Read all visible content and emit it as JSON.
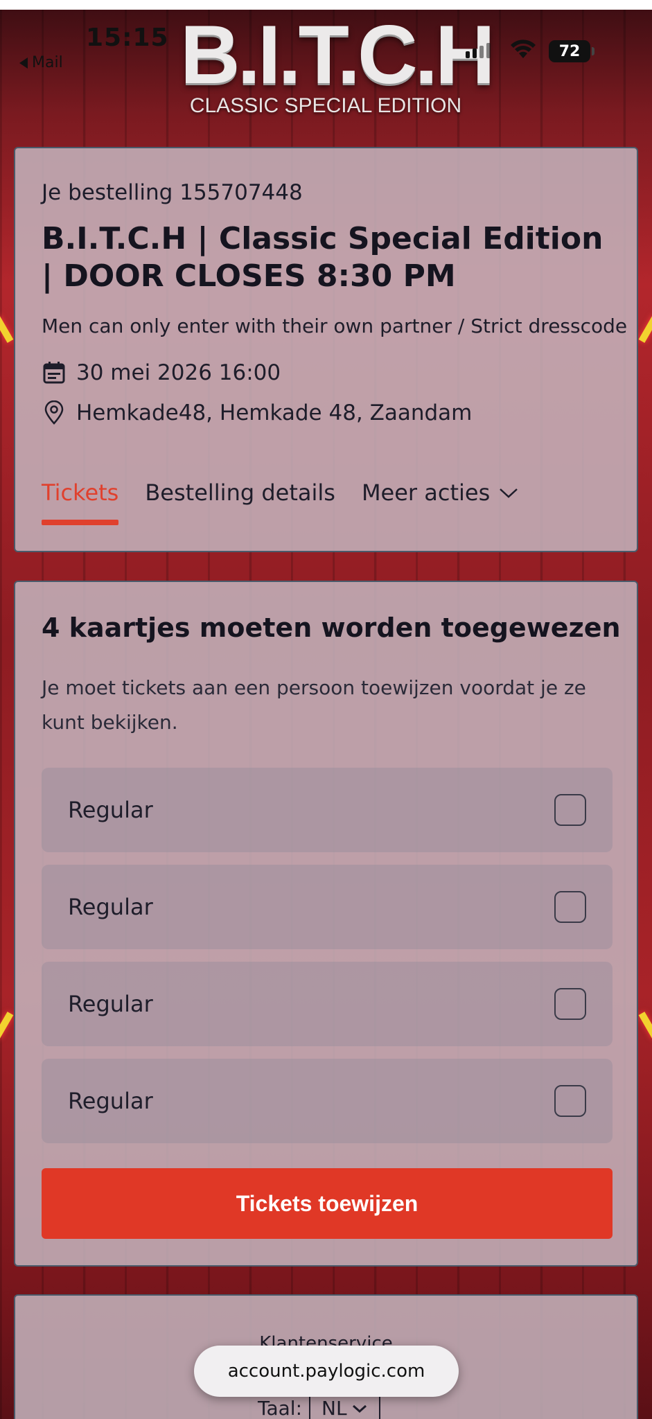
{
  "status_bar": {
    "time": "15:15",
    "back_label": "Mail",
    "battery": "72"
  },
  "logo": {
    "main": "B.I.T.C.H",
    "sub": "CLASSIC SPECIAL EDITION"
  },
  "event": {
    "order_label": "Je bestelling 155707448",
    "title": "B.I.T.C.H | Classic Special Edition | DOOR CLOSES 8:30 PM",
    "subtitle": "Men can only enter with their own partner / Strict dresscode",
    "date": "30 mei 2026 16:00",
    "location": "Hemkade48, Hemkade 48, Zaandam",
    "tabs": [
      {
        "label": "Tickets",
        "active": true
      },
      {
        "label": "Bestelling details",
        "active": false
      },
      {
        "label": "Meer acties",
        "active": false
      }
    ]
  },
  "tickets": {
    "heading": "4 kaartjes moeten worden toegewezen",
    "description": "Je moet tickets aan een persoon toewijzen voordat je ze kunt bekijken.",
    "items": [
      {
        "label": "Regular",
        "checked": false
      },
      {
        "label": "Regular",
        "checked": false
      },
      {
        "label": "Regular",
        "checked": false
      },
      {
        "label": "Regular",
        "checked": false
      }
    ],
    "assign_button": "Tickets toewijzen"
  },
  "footer": {
    "title": "Klantenservice",
    "language_label": "Taal:",
    "language_value": "NL"
  },
  "browser": {
    "url": "account.paylogic.com"
  },
  "colors": {
    "accent": "#e03826",
    "tab_active": "#e0402d",
    "text_dark": "#15141f"
  }
}
